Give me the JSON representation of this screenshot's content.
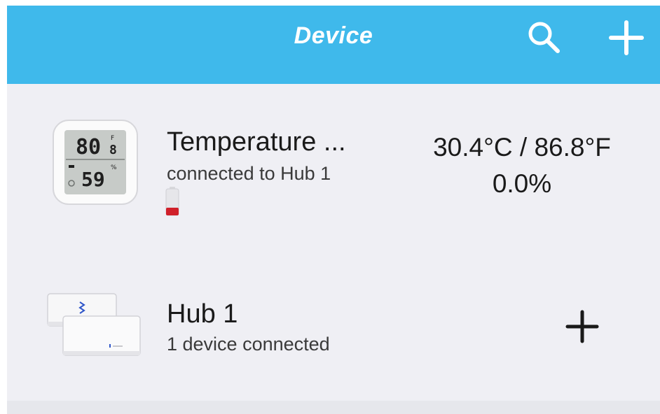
{
  "header": {
    "title": "Device",
    "search_icon": "search-icon",
    "add_icon": "plus-icon",
    "background_color": "#3fb9eb"
  },
  "devices": [
    {
      "name": "Temperature ...",
      "status": "connected to Hub 1",
      "temperature": "30.4°C / 86.8°F",
      "humidity": "0.0%",
      "thumbnail": {
        "top_digits": "80",
        "top_small": "8",
        "top_unit": "F",
        "bottom_digits": "59",
        "bottom_unit": "%"
      },
      "battery_level": 0.15,
      "battery_color": "#d0202a",
      "icon": "thermo-hygrometer-icon"
    },
    {
      "name": "Hub 1",
      "status": "1 device connected",
      "action_icon": "plus-icon",
      "icon": "hub-device-icon"
    }
  ]
}
